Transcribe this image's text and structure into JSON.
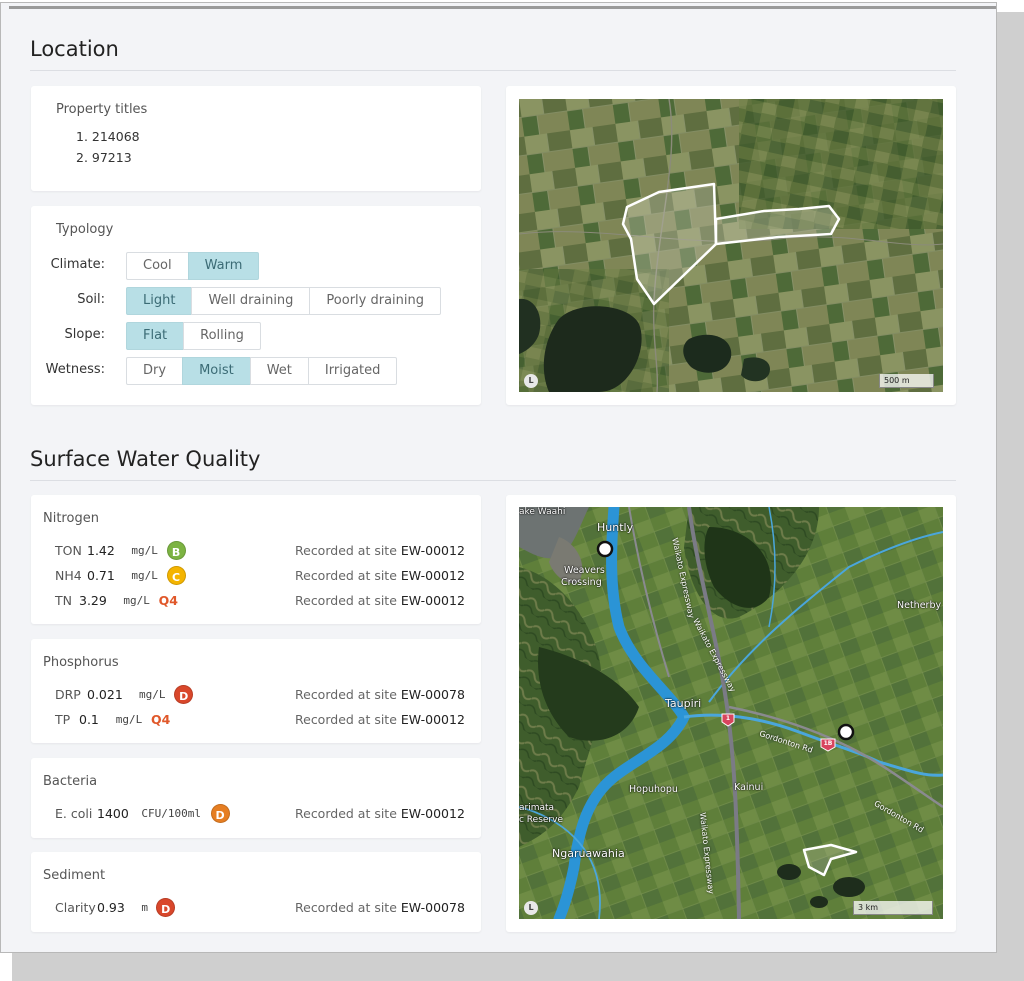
{
  "sections": {
    "location_title": "Location",
    "water_title": "Surface Water Quality"
  },
  "property_titles": {
    "label": "Property titles",
    "items": [
      "1. 214068",
      "2. 97213"
    ]
  },
  "typology": {
    "label": "Typology",
    "rows": [
      {
        "label": "Climate:",
        "options": [
          "Cool",
          "Warm"
        ],
        "selected": "Warm"
      },
      {
        "label": "Soil:",
        "options": [
          "Light",
          "Well draining",
          "Poorly draining"
        ],
        "selected": "Light"
      },
      {
        "label": "Slope:",
        "options": [
          "Flat",
          "Rolling"
        ],
        "selected": "Flat"
      },
      {
        "label": "Wetness:",
        "options": [
          "Dry",
          "Moist",
          "Wet",
          "Irrigated"
        ],
        "selected": "Moist"
      }
    ]
  },
  "location_map": {
    "attribution": "L",
    "scale": "500 m"
  },
  "water_map": {
    "attribution": "L",
    "scale": "3 km",
    "place_labels": [
      "Huntly",
      "Weavers",
      "Crossing",
      "Netherby",
      "Taupiri",
      "Hopuhopu",
      "Kainui",
      "Ngaruawahia",
      "arimata",
      "c Reserve",
      "ake Waahi"
    ],
    "road_labels": [
      "Waikato Expressway",
      "Waikato Expressway",
      "Gordonton Rd",
      "Gordonton Rd",
      "Waikato Expressway"
    ],
    "shields": [
      "1",
      "1B"
    ]
  },
  "recorded_prefix": "Recorded at site",
  "water_quality": {
    "nitrogen": {
      "title": "Nitrogen",
      "rows": [
        {
          "code": "TON",
          "value": "1.42",
          "unit": "mg/L",
          "grade": "B",
          "grade_color": "#7cb342",
          "site": "EW-00012"
        },
        {
          "code": "NH4",
          "value": "0.71",
          "unit": "mg/L",
          "grade": "C",
          "grade_color": "#f4b400",
          "site": "EW-00012"
        },
        {
          "code": "TN",
          "value": "3.29",
          "unit": "mg/L",
          "grade": "Q4",
          "grade_color": "#e0582a",
          "site": "EW-00012"
        }
      ]
    },
    "phosphorus": {
      "title": "Phosphorus",
      "rows": [
        {
          "code": "DRP",
          "value": "0.021",
          "unit": "mg/L",
          "grade": "D",
          "grade_color": "#d9472b",
          "site": "EW-00078"
        },
        {
          "code": "TP",
          "value": "0.1",
          "unit": "mg/L",
          "grade": "Q4",
          "grade_color": "#e0582a",
          "site": "EW-00012"
        }
      ]
    },
    "bacteria": {
      "title": "Bacteria",
      "rows": [
        {
          "code": "E. coli",
          "value": "1400",
          "unit": "CFU/100ml",
          "grade": "D",
          "grade_color": "#e67e22",
          "site": "EW-00012"
        }
      ]
    },
    "sediment": {
      "title": "Sediment",
      "rows": [
        {
          "code": "Clarity",
          "value": "0.93",
          "unit": "m",
          "grade": "D",
          "grade_color": "#d9472b",
          "site": "EW-00078"
        }
      ]
    }
  }
}
